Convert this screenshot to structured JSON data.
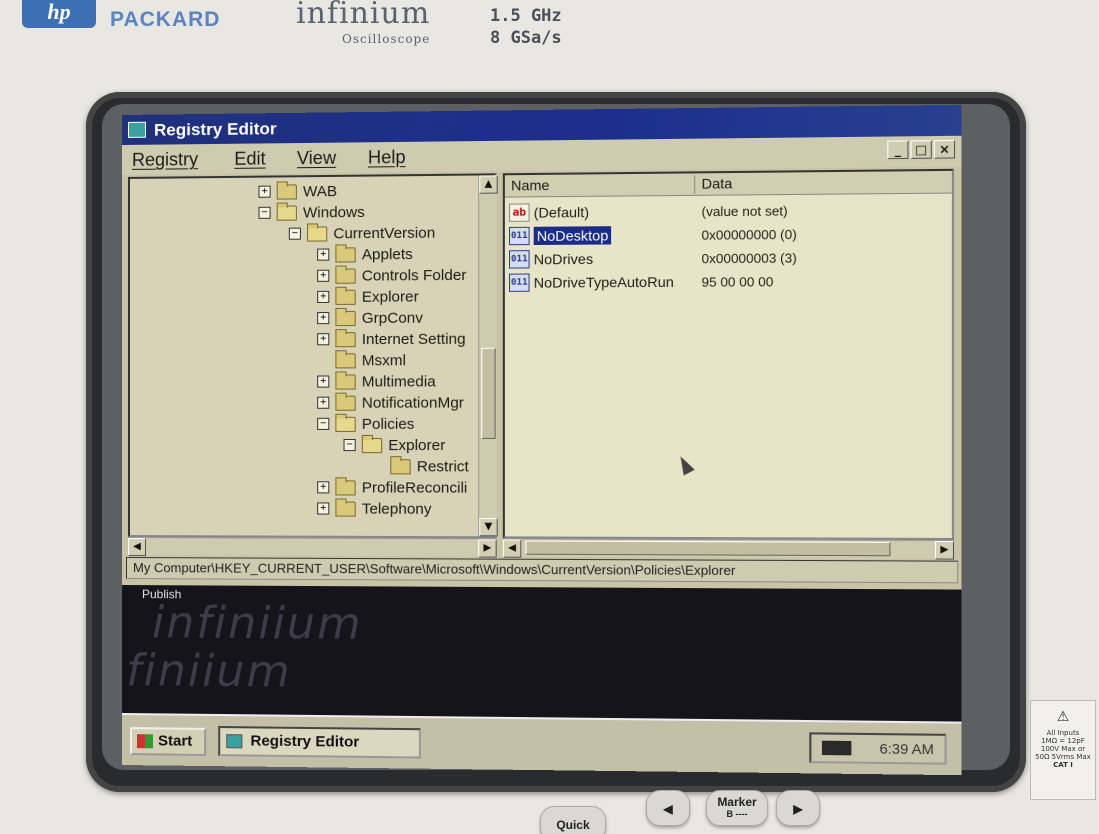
{
  "bezel": {
    "logo": "hp",
    "company": "PACKARD",
    "product": "infinium",
    "product_sub": "Oscilloscope",
    "spec_bandwidth": "1.5 GHz",
    "spec_samplerate": "8 GSa/s"
  },
  "window": {
    "title": "Registry Editor",
    "menu": [
      "Registry",
      "Edit",
      "View",
      "Help"
    ],
    "controls": [
      "_",
      "□",
      "×"
    ]
  },
  "tree": {
    "items": [
      {
        "label": "WAB",
        "expander": "+",
        "open": false
      },
      {
        "label": "Windows",
        "expander": "−",
        "open": true
      },
      {
        "label": "CurrentVersion",
        "expander": "−",
        "open": true
      },
      {
        "label": "Applets",
        "expander": "+",
        "open": false
      },
      {
        "label": "Controls Folder",
        "expander": "+",
        "open": false
      },
      {
        "label": "Explorer",
        "expander": "+",
        "open": false
      },
      {
        "label": "GrpConv",
        "expander": "+",
        "open": false
      },
      {
        "label": "Internet Setting",
        "expander": "+",
        "open": false
      },
      {
        "label": "Msxml",
        "expander": "",
        "open": false
      },
      {
        "label": "Multimedia",
        "expander": "+",
        "open": false
      },
      {
        "label": "NotificationMgr",
        "expander": "+",
        "open": false
      },
      {
        "label": "Policies",
        "expander": "−",
        "open": true
      },
      {
        "label": "Explorer",
        "expander": "−",
        "open": true
      },
      {
        "label": "Restrict",
        "expander": "",
        "open": false
      },
      {
        "label": "ProfileReconcili",
        "expander": "+",
        "open": false
      },
      {
        "label": "Telephony",
        "expander": "+",
        "open": false
      }
    ]
  },
  "list": {
    "columns": [
      "Name",
      "Data"
    ],
    "rows": [
      {
        "icon": "ab",
        "name": "(Default)",
        "data": "(value not set)",
        "selected": false
      },
      {
        "icon": "011",
        "name": "NoDesktop",
        "data": "0x00000000 (0)",
        "selected": true
      },
      {
        "icon": "011",
        "name": "NoDrives",
        "data": "0x00000003 (3)",
        "selected": false
      },
      {
        "icon": "011",
        "name": "NoDriveTypeAutoRun",
        "data": "95 00 00 00",
        "selected": false
      }
    ]
  },
  "statusbar": {
    "path": "My Computer\\HKEY_CURRENT_USER\\Software\\Microsoft\\Windows\\CurrentVersion\\Policies\\Explorer"
  },
  "desktop": {
    "icon_label": "Publish",
    "watermark": "infiniium"
  },
  "taskbar": {
    "start_label": "Start",
    "task_label": "Registry Editor",
    "clock": "6:39 AM"
  },
  "device": {
    "side_label_lines": [
      "All Inputs",
      "1MΩ = 12pF",
      "100V Max or",
      "50Ω 5Vrms Max",
      "CAT I"
    ],
    "quick_label": "Quick",
    "marker_label": "Marker",
    "marker_sub": "B ----"
  }
}
